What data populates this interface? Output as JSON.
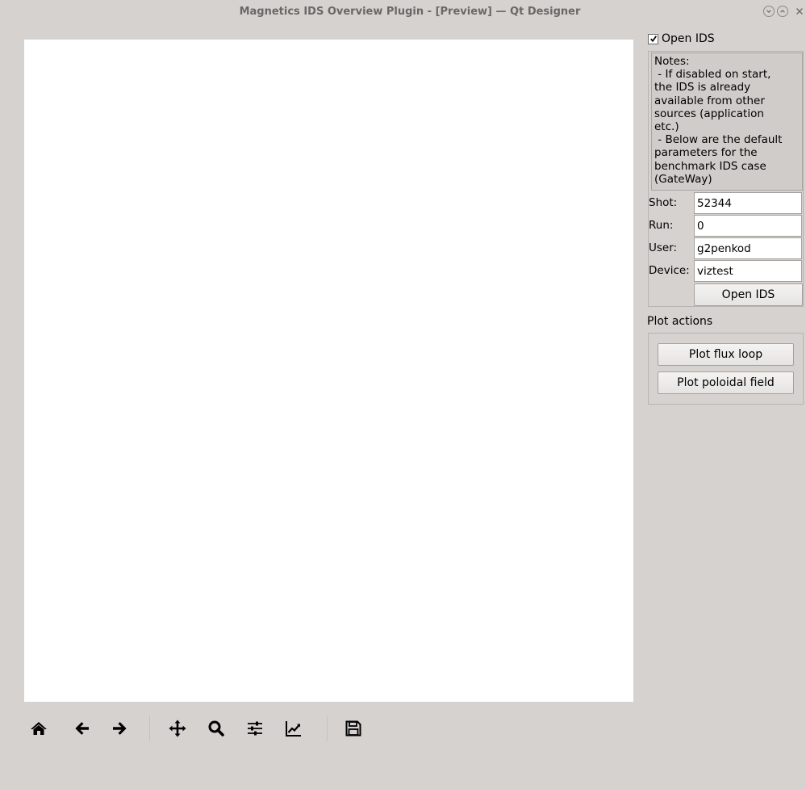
{
  "window": {
    "title": "Magnetics IDS Overview Plugin - [Preview] — Qt Designer"
  },
  "titlebar_buttons": {
    "minimize_icon": "chevron-down-icon",
    "maximize_icon": "chevron-up-icon",
    "close_icon": "close-icon"
  },
  "toolbar": {
    "items": [
      "home-icon",
      "back-arrow-icon",
      "forward-arrow-icon",
      "pan-icon",
      "zoom-icon",
      "configure-subplots-icon",
      "edit-axis-icon",
      "save-icon"
    ]
  },
  "ids_panel": {
    "open_checkbox_label": "Open IDS",
    "open_checked": true,
    "notes": "Notes:\n - If disabled on start,\nthe IDS is already\navailable from other\nsources (application\netc.)\n - Below are the default\nparameters for the\nbenchmark IDS case\n(GateWay)",
    "shot_label": "Shot:",
    "shot_value": "52344",
    "run_label": "Run:",
    "run_value": "0",
    "user_label": "User:",
    "user_value": "g2penkod",
    "device_label": "Device:",
    "device_value": "viztest",
    "open_button": "Open IDS"
  },
  "plot_actions": {
    "label": "Plot actions",
    "flux_loop_button": "Plot flux loop",
    "poloidal_field_button": "Plot poloidal field"
  },
  "colors": {
    "window_bg": "#d6d2d0",
    "canvas_bg": "#ffffff",
    "notes_bg": "#d0ccc9",
    "icon": "#000000"
  }
}
